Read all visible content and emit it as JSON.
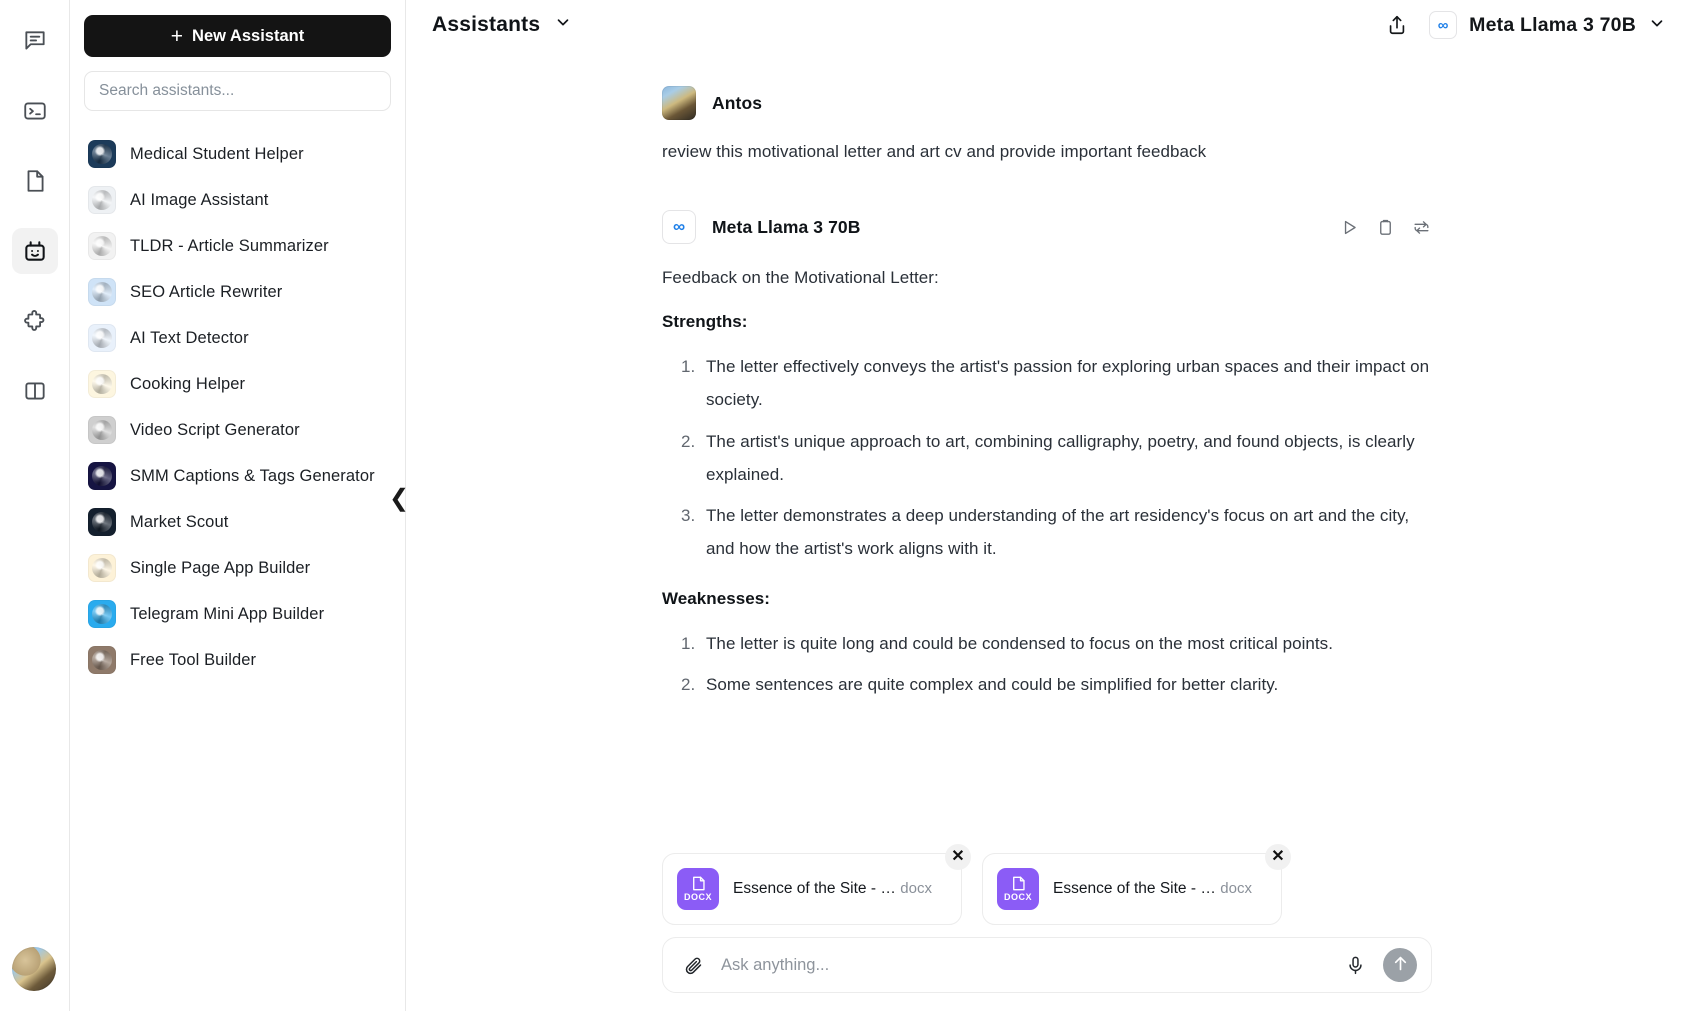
{
  "rail": {
    "items": [
      {
        "icon": "chat-bubble-icon",
        "name": "rail-item-chat",
        "active": false
      },
      {
        "icon": "terminal-icon",
        "name": "rail-item-terminal",
        "active": false
      },
      {
        "icon": "document-icon",
        "name": "rail-item-documents",
        "active": false
      },
      {
        "icon": "bot-icon",
        "name": "rail-item-assistants",
        "active": true
      },
      {
        "icon": "puzzle-icon",
        "name": "rail-item-plugins",
        "active": false
      },
      {
        "icon": "split-panel-icon",
        "name": "rail-item-layout",
        "active": false
      }
    ],
    "avatar": "user-avatar"
  },
  "sidebar": {
    "new_assistant_label": "New Assistant",
    "new_assistant_plus": "+",
    "search_placeholder": "Search assistants...",
    "search_value": "",
    "items": [
      {
        "label": "Medical Student Helper",
        "color": "#1c3b5a"
      },
      {
        "label": "AI Image Assistant",
        "color": "#eef1f4"
      },
      {
        "label": "TLDR - Article Summarizer",
        "color": "#f2f2f2"
      },
      {
        "label": "SEO Article Rewriter",
        "color": "#cfe3f7"
      },
      {
        "label": "AI Text Detector",
        "color": "#e9f1fb"
      },
      {
        "label": "Cooking Helper",
        "color": "#fdf6e0"
      },
      {
        "label": "Video Script Generator",
        "color": "#cfcfcf"
      },
      {
        "label": "SMM Captions & Tags Generator",
        "color": "#161442"
      },
      {
        "label": "Market Scout",
        "color": "#14202e"
      },
      {
        "label": "Single Page App Builder",
        "color": "#fdf2d8"
      },
      {
        "label": "Telegram Mini App Builder",
        "color": "#2aabee"
      },
      {
        "label": "Free Tool Builder",
        "color": "#8f7a6a"
      }
    ]
  },
  "topbar": {
    "title": "Assistants",
    "share_icon": "share-icon",
    "model_badge_glyph": "∞",
    "model_name": "Meta Llama 3 70B",
    "chevron": "⌄"
  },
  "collapse_handle": "❮",
  "conversation": {
    "user": {
      "name": "Antos",
      "text": "review this motivational letter and art cv and provide important feedback"
    },
    "assistant": {
      "name": "Meta Llama 3 70B",
      "badge_glyph": "∞",
      "actions": [
        {
          "name": "play-icon",
          "label": "Read aloud"
        },
        {
          "name": "copy-icon",
          "label": "Copy"
        },
        {
          "name": "regenerate-icon",
          "label": "Regenerate"
        }
      ],
      "intro": "Feedback on the Motivational Letter:",
      "strengths_heading": "Strengths:",
      "strengths": [
        "The letter effectively conveys the artist's passion for exploring urban spaces and their impact on society.",
        "The artist's unique approach to art, combining calligraphy, poetry, and found objects, is clearly explained.",
        "The letter demonstrates a deep understanding of the art residency's focus on art and the city, and how the artist's work aligns with it."
      ],
      "weaknesses_heading": "Weaknesses:",
      "weaknesses": [
        "The letter is quite long and could be condensed to focus on the most critical points.",
        "Some sentences are quite complex and could be simplified for better clarity."
      ]
    }
  },
  "composer": {
    "attachments": [
      {
        "name": "Essence of the Site - …",
        "type": "docx",
        "badge": "DOCX",
        "close": "✕"
      },
      {
        "name": "Essence of the Site - …",
        "type": "docx",
        "badge": "DOCX",
        "close": "✕"
      }
    ],
    "attach_icon": "paperclip-icon",
    "placeholder": "Ask anything...",
    "value": "",
    "mic_icon": "microphone-icon",
    "send_icon": "send-arrow-icon"
  },
  "colors": {
    "accent_button": "#141414",
    "model_blue": "#1e7fe8",
    "docx_purple": "#8b5cf6",
    "send_grey": "#9ba1a7"
  }
}
